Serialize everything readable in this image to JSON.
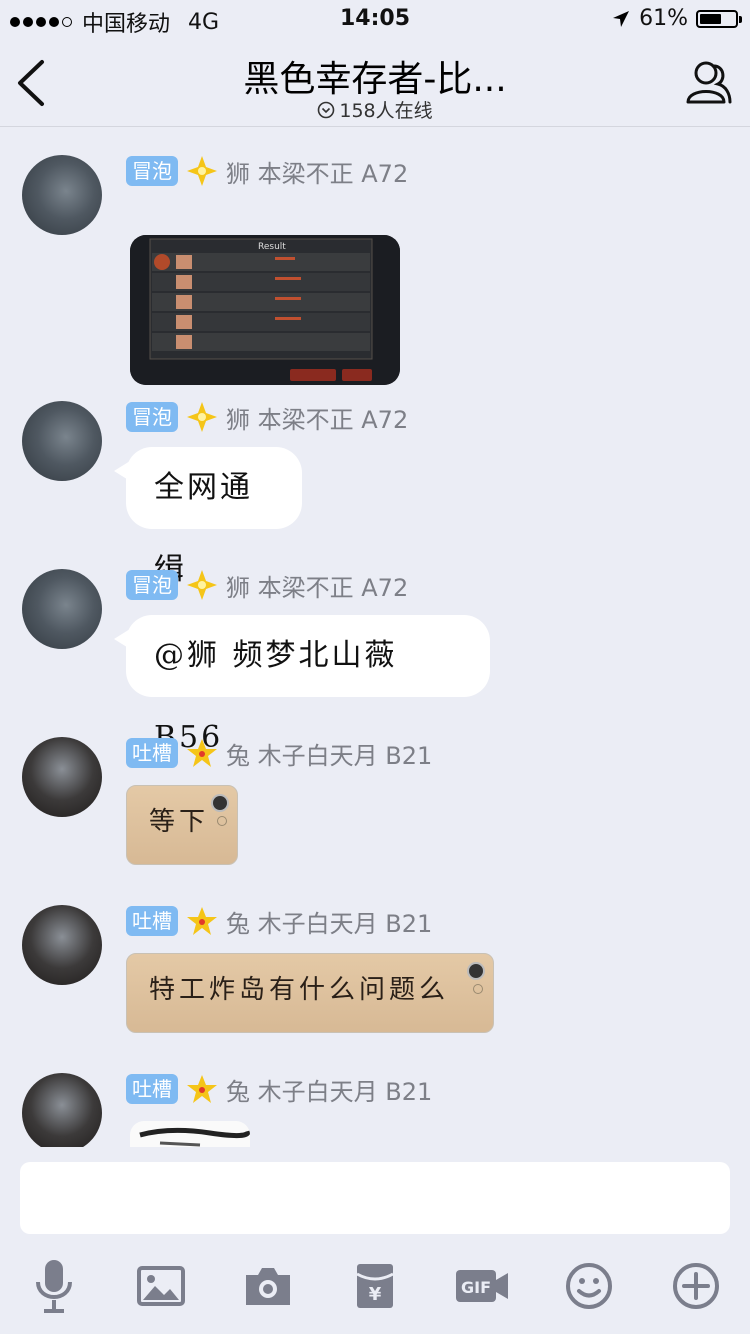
{
  "status_bar": {
    "carrier": "中国移动",
    "network": "4G",
    "time": "14:05",
    "battery": "61%",
    "battery_level": 0.61
  },
  "header": {
    "title": "黑色幸存者-比...",
    "online": "158人在线"
  },
  "messages": [
    {
      "badge": "冒泡",
      "sender": "狮 本梁不正 A72",
      "type": "image"
    },
    {
      "badge": "冒泡",
      "sender": "狮 本梁不正 A72",
      "text": "全网通缉"
    },
    {
      "badge": "冒泡",
      "sender": "狮 本梁不正 A72",
      "text": "@狮 频梦北山薇 B56"
    },
    {
      "badge": "吐槽",
      "sender": "兔 木子白天月 B21",
      "sticker_text": "等下"
    },
    {
      "badge": "吐槽",
      "sender": "兔 木子白天月 B21",
      "sticker_text": "特工炸岛有什么问题么"
    },
    {
      "badge": "吐槽",
      "sender": "兔 木子白天月 B21",
      "type": "image"
    }
  ],
  "image_message": {
    "title": "Result",
    "button_left": "",
    "button_right": ""
  },
  "input": {
    "placeholder": ""
  },
  "toolbar_icons": [
    "microphone-icon",
    "image-icon",
    "camera-icon",
    "red-packet-icon",
    "gif-icon",
    "emoji-icon",
    "plus-icon"
  ],
  "colors": {
    "badge": "#7fbaf2",
    "background": "#ebedf5",
    "sender": "#7d7f87"
  }
}
